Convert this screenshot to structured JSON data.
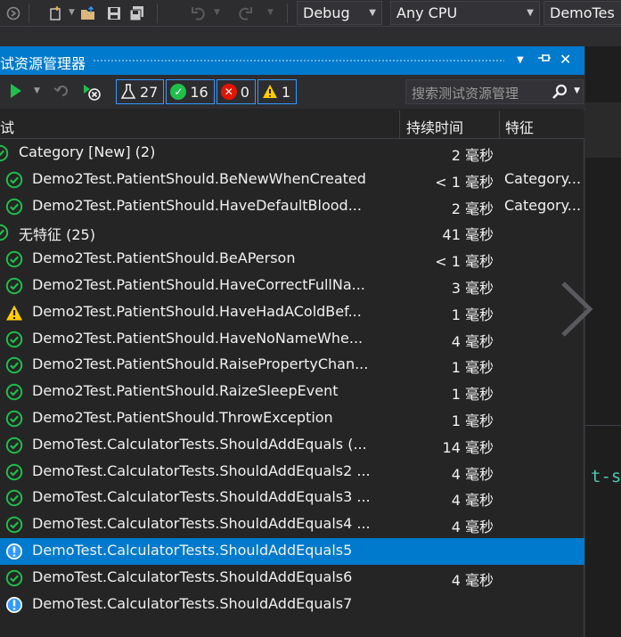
{
  "toolbar": {
    "config": "Debug",
    "platform": "Any CPU",
    "project": "DemoTes"
  },
  "panel": {
    "title": "试资源管理器",
    "counts": {
      "total": "27",
      "passed": "16",
      "failed": "0",
      "warning": "1"
    },
    "search_placeholder": "搜索测试资源管理",
    "columns": {
      "test": "试",
      "duration": "持续时间",
      "traits": "特征"
    },
    "rows": [
      {
        "status": "passed",
        "name": "Category [New] (2)",
        "duration": "2 毫秒",
        "trait": "",
        "group": true
      },
      {
        "status": "passed",
        "name": "Demo2Test.PatientShould.BeNewWhenCreated",
        "duration": "< 1 毫秒",
        "trait": "Category...",
        "group": false
      },
      {
        "status": "passed",
        "name": "Demo2Test.PatientShould.HaveDefaultBlood...",
        "duration": "2 毫秒",
        "trait": "Category...",
        "group": false
      },
      {
        "status": "passed",
        "name": "无特征 (25)",
        "duration": "41 毫秒",
        "trait": "",
        "group": true
      },
      {
        "status": "passed",
        "name": "Demo2Test.PatientShould.BeAPerson",
        "duration": "< 1 毫秒",
        "trait": "",
        "group": false
      },
      {
        "status": "passed",
        "name": "Demo2Test.PatientShould.HaveCorrectFullNa...",
        "duration": "3 毫秒",
        "trait": "",
        "group": false
      },
      {
        "status": "warning",
        "name": "Demo2Test.PatientShould.HaveHadAColdBef...",
        "duration": "1 毫秒",
        "trait": "",
        "group": false
      },
      {
        "status": "passed",
        "name": "Demo2Test.PatientShould.HaveNoNameWhe...",
        "duration": "4 毫秒",
        "trait": "",
        "group": false
      },
      {
        "status": "passed",
        "name": "Demo2Test.PatientShould.RaisePropertyChan...",
        "duration": "1 毫秒",
        "trait": "",
        "group": false
      },
      {
        "status": "passed",
        "name": "Demo2Test.PatientShould.RaizeSleepEvent",
        "duration": "1 毫秒",
        "trait": "",
        "group": false
      },
      {
        "status": "passed",
        "name": "Demo2Test.PatientShould.ThrowException",
        "duration": "1 毫秒",
        "trait": "",
        "group": false
      },
      {
        "status": "passed",
        "name": "DemoTest.CalculatorTests.ShouldAddEquals (...",
        "duration": "14 毫秒",
        "trait": "",
        "group": false
      },
      {
        "status": "passed",
        "name": "DemoTest.CalculatorTests.ShouldAddEquals2 ...",
        "duration": "4 毫秒",
        "trait": "",
        "group": false
      },
      {
        "status": "passed",
        "name": "DemoTest.CalculatorTests.ShouldAddEquals3 ...",
        "duration": "4 毫秒",
        "trait": "",
        "group": false
      },
      {
        "status": "passed",
        "name": "DemoTest.CalculatorTests.ShouldAddEquals4 ...",
        "duration": "4 毫秒",
        "trait": "",
        "group": false
      },
      {
        "status": "not-run",
        "name": "DemoTest.CalculatorTests.ShouldAddEquals5",
        "duration": "",
        "trait": "",
        "group": false,
        "selected": true
      },
      {
        "status": "passed",
        "name": "DemoTest.CalculatorTests.ShouldAddEquals6",
        "duration": "4 毫秒",
        "trait": "",
        "group": false
      },
      {
        "status": "not-run",
        "name": "DemoTest.CalculatorTests.ShouldAddEquals7",
        "duration": "",
        "trait": "",
        "group": false
      }
    ]
  },
  "editor": {
    "code_fragment": "t-s"
  },
  "colors": {
    "accent": "#007acc",
    "passed": "#1fbf4a",
    "failed": "#e51400",
    "warning": "#ffcc00",
    "not_run": "#3399ff"
  },
  "icons": {
    "passed": "check-circle-icon",
    "warning": "warning-triangle-icon",
    "not-run": "info-circle-icon",
    "failed": "x-circle-icon"
  }
}
